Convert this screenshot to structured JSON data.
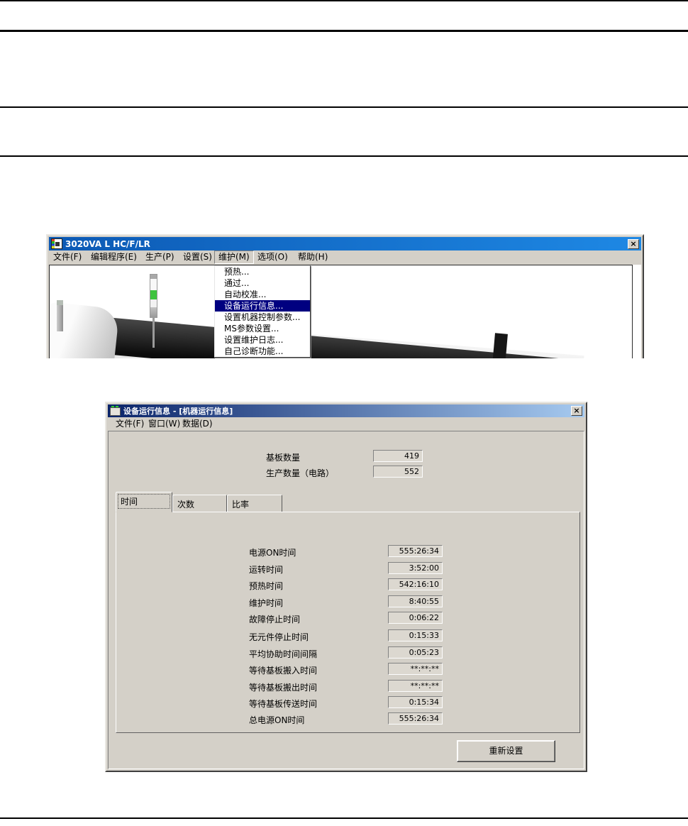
{
  "colors": {
    "window_gray": "#d4d0c8",
    "menu_highlight": "#000080",
    "title1_gradient_start": "#0c59b4",
    "title1_gradient_end": "#1e88e4",
    "title2_gradient_start": "#0a246a",
    "title2_gradient_end": "#a6caf0",
    "signal_green": "#3fc33f"
  },
  "icons": {
    "close": "×"
  },
  "window1": {
    "title": "3020VA L HC/F/LR",
    "menubar": {
      "items": [
        {
          "label": "文件(F)"
        },
        {
          "label": "编辑程序(E)"
        },
        {
          "label": "生产(P)"
        },
        {
          "label": "设置(S)"
        },
        {
          "label": "维护(M)",
          "open": true
        },
        {
          "label": "选项(O)"
        },
        {
          "label": "帮助(H)"
        }
      ]
    },
    "dropdown": {
      "items": [
        {
          "label": "预热..."
        },
        {
          "label": "通过..."
        },
        {
          "label": "自动校准..."
        },
        {
          "label": "设备运行信息...",
          "highlighted": true
        },
        {
          "label": "设置机器控制参数..."
        },
        {
          "label": "MS参数设置..."
        },
        {
          "label": "设置维护日志..."
        },
        {
          "label": "自己诊断功能..."
        }
      ]
    }
  },
  "window2": {
    "title": "设备运行信息 - [机器运行信息]",
    "menubar": {
      "items": [
        {
          "label": "文件(F)"
        },
        {
          "label": "窗口(W)"
        },
        {
          "label": "数据(D)"
        }
      ]
    },
    "counters": [
      {
        "label": "基板数量",
        "value": "419"
      },
      {
        "label": "生产数量（电路）",
        "value": "552"
      }
    ],
    "tabs": [
      {
        "label": "时间",
        "active": true
      },
      {
        "label": "次数",
        "active": false
      },
      {
        "label": "比率",
        "active": false
      }
    ],
    "time_fields": [
      {
        "label": "电源ON时间",
        "value": "555:26:34"
      },
      {
        "label": "运转时间",
        "value": "3:52:00"
      },
      {
        "label": "预热时间",
        "value": "542:16:10"
      },
      {
        "label": "维护时间",
        "value": "8:40:55"
      },
      {
        "label": "故障停止时间",
        "value": "0:06:22"
      },
      {
        "label": "无元件停止时间",
        "value": "0:15:33"
      },
      {
        "label": "平均协助时间间隔",
        "value": "0:05:23"
      },
      {
        "label": "等待基板搬入时间",
        "value": "**:**:**"
      },
      {
        "label": "等待基板搬出时间",
        "value": "**:**:**"
      },
      {
        "label": "等待基板传送时间",
        "value": "0:15:34"
      },
      {
        "label": "总电源ON时间",
        "value": "555:26:34"
      }
    ],
    "reset_button": "重新设置"
  }
}
